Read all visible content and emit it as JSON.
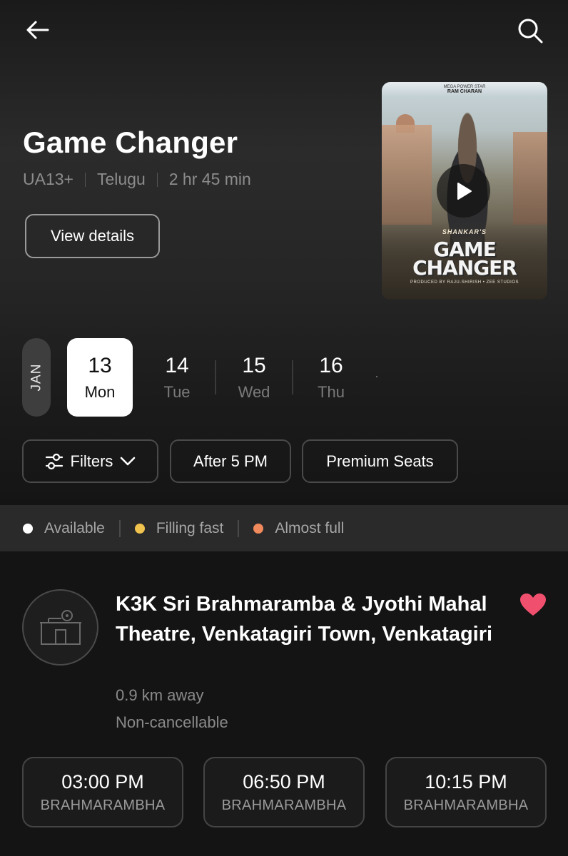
{
  "topbar": {
    "back_icon": "arrow-left-icon",
    "search_icon": "search-icon"
  },
  "movie": {
    "title": "Game Changer",
    "certificate": "UA13+",
    "language": "Telugu",
    "duration": "2 hr 45 min",
    "view_details_label": "View details",
    "poster": {
      "top_text": "MEGA POWER STAR",
      "star_name": "RAM CHARAN",
      "director_text": "SHANKAR'S",
      "logo_line1": "GAME",
      "logo_line2": "CHANGER",
      "produced_by": "PRODUCED BY RAJU-SHIRISH • ZEE STUDIOS",
      "play_icon": "play-icon"
    }
  },
  "dates": {
    "month": "JAN",
    "items": [
      {
        "num": "13",
        "day": "Mon",
        "selected": true
      },
      {
        "num": "14",
        "day": "Tue",
        "selected": false
      },
      {
        "num": "15",
        "day": "Wed",
        "selected": false
      },
      {
        "num": "16",
        "day": "Thu",
        "selected": false
      }
    ]
  },
  "filters": {
    "filters_label": "Filters",
    "after5_label": "After 5 PM",
    "premium_label": "Premium Seats"
  },
  "legend": {
    "available": "Available",
    "filling": "Filling fast",
    "almost": "Almost full",
    "colors": {
      "available": "#ffffff",
      "filling": "#f0c24e",
      "almost": "#f08a5d"
    }
  },
  "theatre": {
    "name": "K3K Sri Brahmaramba & Jyothi Mahal Theatre, Venkatagiri Town, Venkatagiri",
    "distance": "0.9 km away",
    "cancellation": "Non-cancellable",
    "favorite_color": "#f0506e",
    "showtimes": [
      {
        "time": "03:00 PM",
        "screen": "BRAHMARAMBHA"
      },
      {
        "time": "06:50 PM",
        "screen": "BRAHMARAMBHA"
      },
      {
        "time": "10:15 PM",
        "screen": "BRAHMARAMBHA"
      }
    ]
  }
}
